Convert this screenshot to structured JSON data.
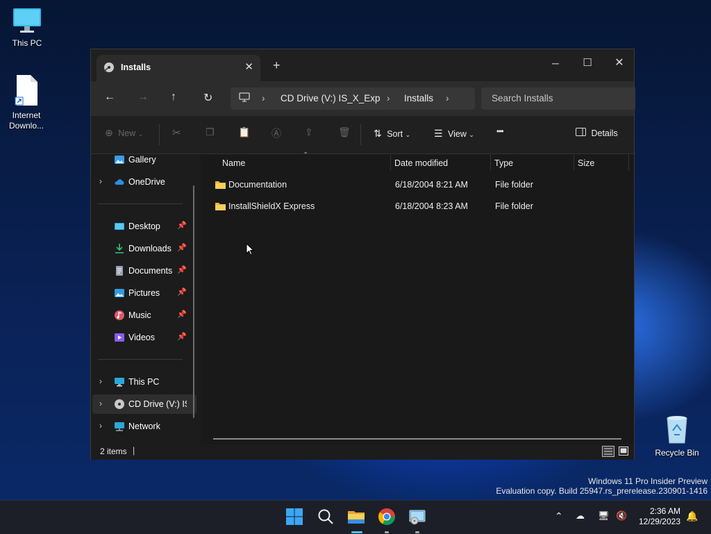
{
  "desktop": {
    "icons": [
      {
        "label": "This PC"
      },
      {
        "label": "Internet Downlo..."
      },
      {
        "label": "Recycle Bin"
      }
    ]
  },
  "window": {
    "tab_title": "Installs",
    "new_tab": "+",
    "controls": {
      "minimize": "─",
      "maximize": "☐",
      "close": "✕"
    },
    "nav": {
      "back": "←",
      "forward": "→",
      "up": "↑",
      "refresh": "↻"
    },
    "breadcrumb": [
      "CD Drive (V:) IS_X_Exp",
      "Installs"
    ],
    "search_placeholder": "Search Installs",
    "commands": {
      "new": "New",
      "sort": "Sort",
      "view": "View",
      "more": "•••",
      "details": "Details"
    },
    "nav_pane": {
      "items": [
        {
          "label": "Gallery"
        },
        {
          "label": "OneDrive"
        },
        {
          "label": "Desktop"
        },
        {
          "label": "Downloads"
        },
        {
          "label": "Documents"
        },
        {
          "label": "Pictures"
        },
        {
          "label": "Music"
        },
        {
          "label": "Videos"
        },
        {
          "label": "This PC"
        },
        {
          "label": "CD Drive (V:) IS_X_Exp"
        },
        {
          "label": "Network"
        }
      ]
    },
    "columns": {
      "name": "Name",
      "date": "Date modified",
      "type": "Type",
      "size": "Size"
    },
    "files": [
      {
        "name": "Documentation",
        "date": "6/18/2004 8:21 AM",
        "type": "File folder",
        "size": ""
      },
      {
        "name": "InstallShieldX Express",
        "date": "6/18/2004 8:23 AM",
        "type": "File folder",
        "size": ""
      }
    ],
    "status": {
      "count": "2 items"
    }
  },
  "watermark": {
    "line1": "Windows 11 Pro Insider Preview",
    "line2": "Evaluation copy. Build 25947.rs_prerelease.230901-1416"
  },
  "taskbar": {
    "time": "2:36 AM",
    "date": "12/29/2023"
  },
  "colors": {
    "accent": "#4cc2ff",
    "folder": "#f2c14e",
    "window_bg": "#1c1c1c"
  }
}
